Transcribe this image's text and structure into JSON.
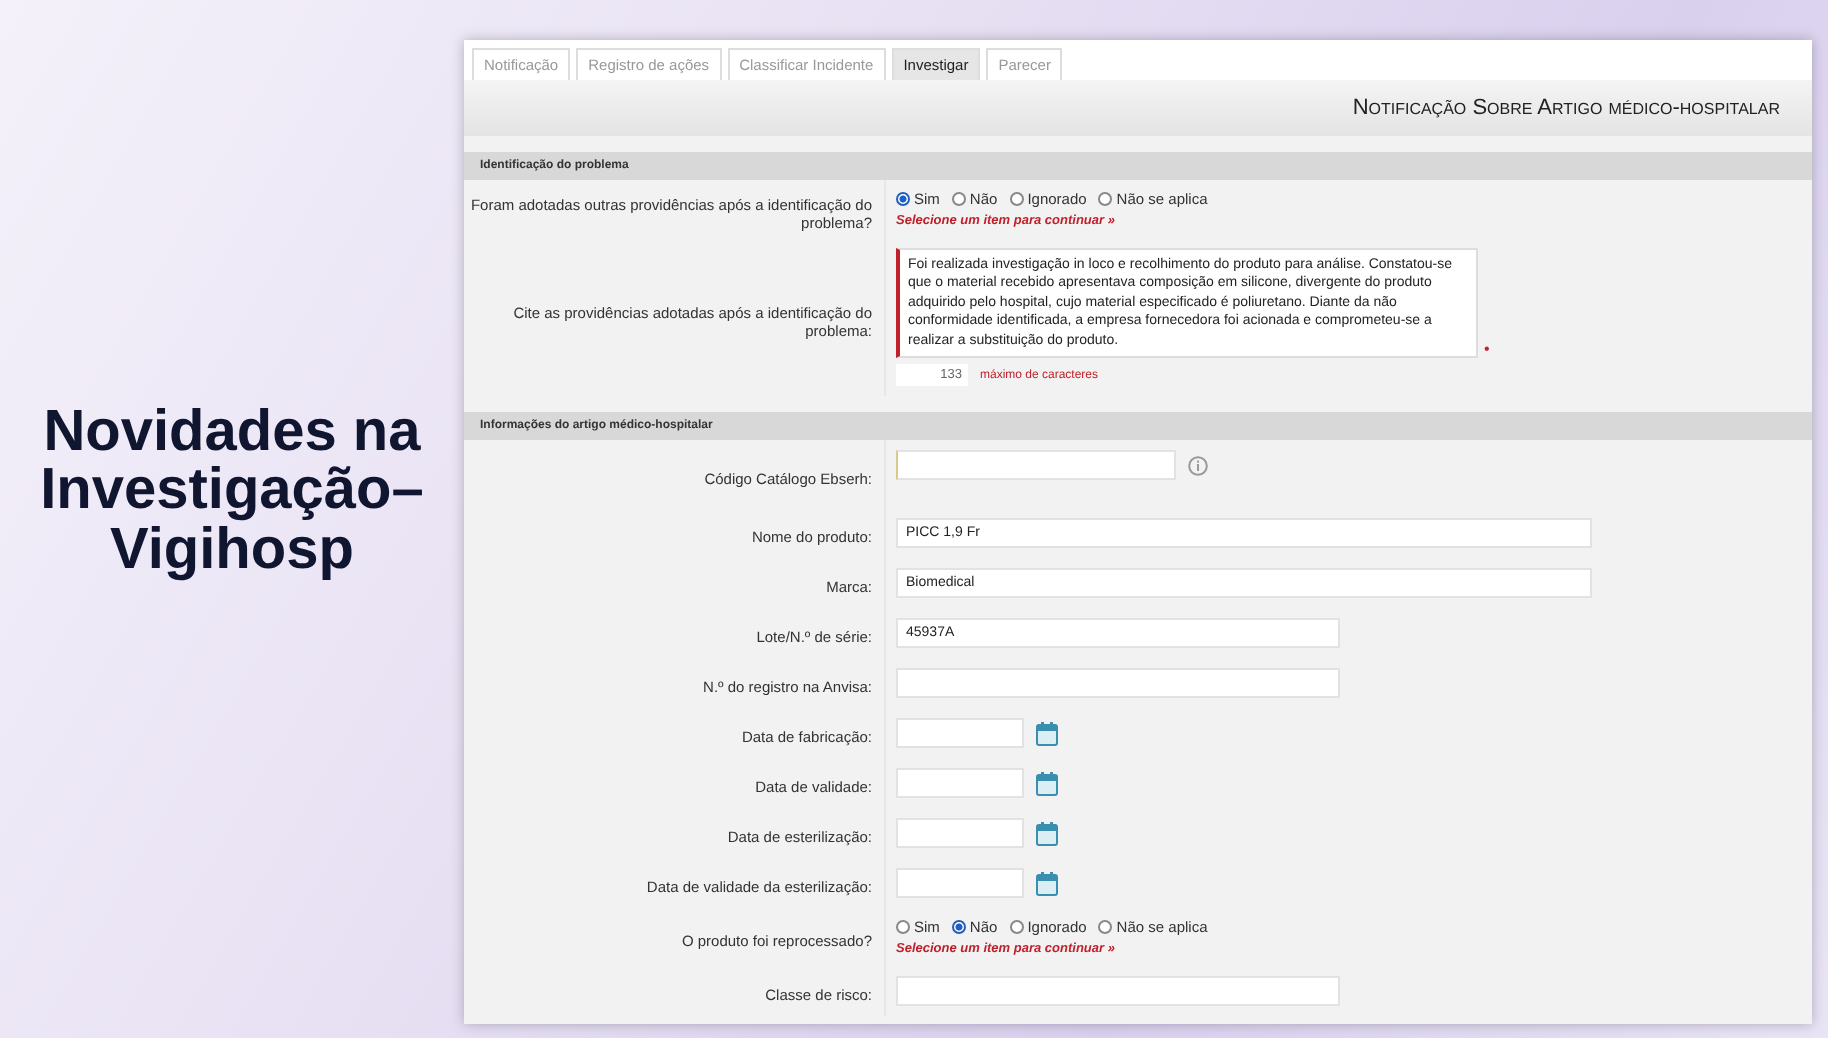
{
  "slide_title": "Novidades na Investigação–Vigihosp",
  "tabs": [
    {
      "label": "Notificação",
      "selected": false
    },
    {
      "label": "Registro de ações",
      "selected": false
    },
    {
      "label": "Classificar Incidente",
      "selected": false
    },
    {
      "label": "Investigar",
      "selected": true
    },
    {
      "label": "Parecer",
      "selected": false
    }
  ],
  "form_title": "Notificação Sobre Artigo médico-hospitalar",
  "sections": [
    {
      "title": "Identificação do problema",
      "rows": [
        {
          "kind": "radio",
          "label": "Foram adotadas outras providências após a identificação do problema?",
          "options": [
            {
              "label": "Sim",
              "selected": true
            },
            {
              "label": "Não",
              "selected": false
            },
            {
              "label": "Ignorado",
              "selected": false
            },
            {
              "label": "Não se aplica",
              "selected": false
            }
          ],
          "hint": "Selecione um item para continuar »"
        },
        {
          "kind": "textarea",
          "label": "Cite as providências adotadas após a identificação do problema:",
          "value": "Foi realizada investigação in loco e recolhimento do produto para análise. Constatou-se que o material recebido apresentava composição em silicone, divergente do produto adquirido pelo hospital, cujo material especificado é poliuretano. Diante da não conformidade identificada, a empresa fornecedora foi acionada e comprometeu-se a realizar a substituição do produto.",
          "required_mark": "•",
          "counter": "133",
          "counter_label": "máximo de caracteres"
        }
      ]
    },
    {
      "title": "Informações do artigo médico-hospitalar",
      "rows": [
        {
          "kind": "code",
          "label": "Código Catálogo Ebserh:"
        },
        {
          "kind": "text",
          "label": "Nome do produto:",
          "value": "PICC 1,9 Fr",
          "wide": true
        },
        {
          "kind": "text",
          "label": "Marca:",
          "value": "Biomedical",
          "wide": true
        },
        {
          "kind": "text",
          "label": "Lote/N.º de série:",
          "value": "45937A",
          "wide": false
        },
        {
          "kind": "text",
          "label": "N.º do registro na Anvisa:",
          "wide": false
        },
        {
          "kind": "date",
          "label": "Data de fabricação:"
        },
        {
          "kind": "date",
          "label": "Data de validade:"
        },
        {
          "kind": "date",
          "label": "Data de esterilização:"
        },
        {
          "kind": "date",
          "label": "Data de validade da esterilização:"
        },
        {
          "kind": "radio",
          "label": "O produto foi reprocessado?",
          "options": [
            {
              "label": "Sim",
              "selected": false
            },
            {
              "label": "Não",
              "selected": true
            },
            {
              "label": "Ignorado",
              "selected": false
            },
            {
              "label": "Não se aplica",
              "selected": false
            }
          ],
          "hint": "Selecione um item para continuar »"
        },
        {
          "kind": "text",
          "label": "Classe de risco:",
          "wide": false
        }
      ]
    }
  ]
}
